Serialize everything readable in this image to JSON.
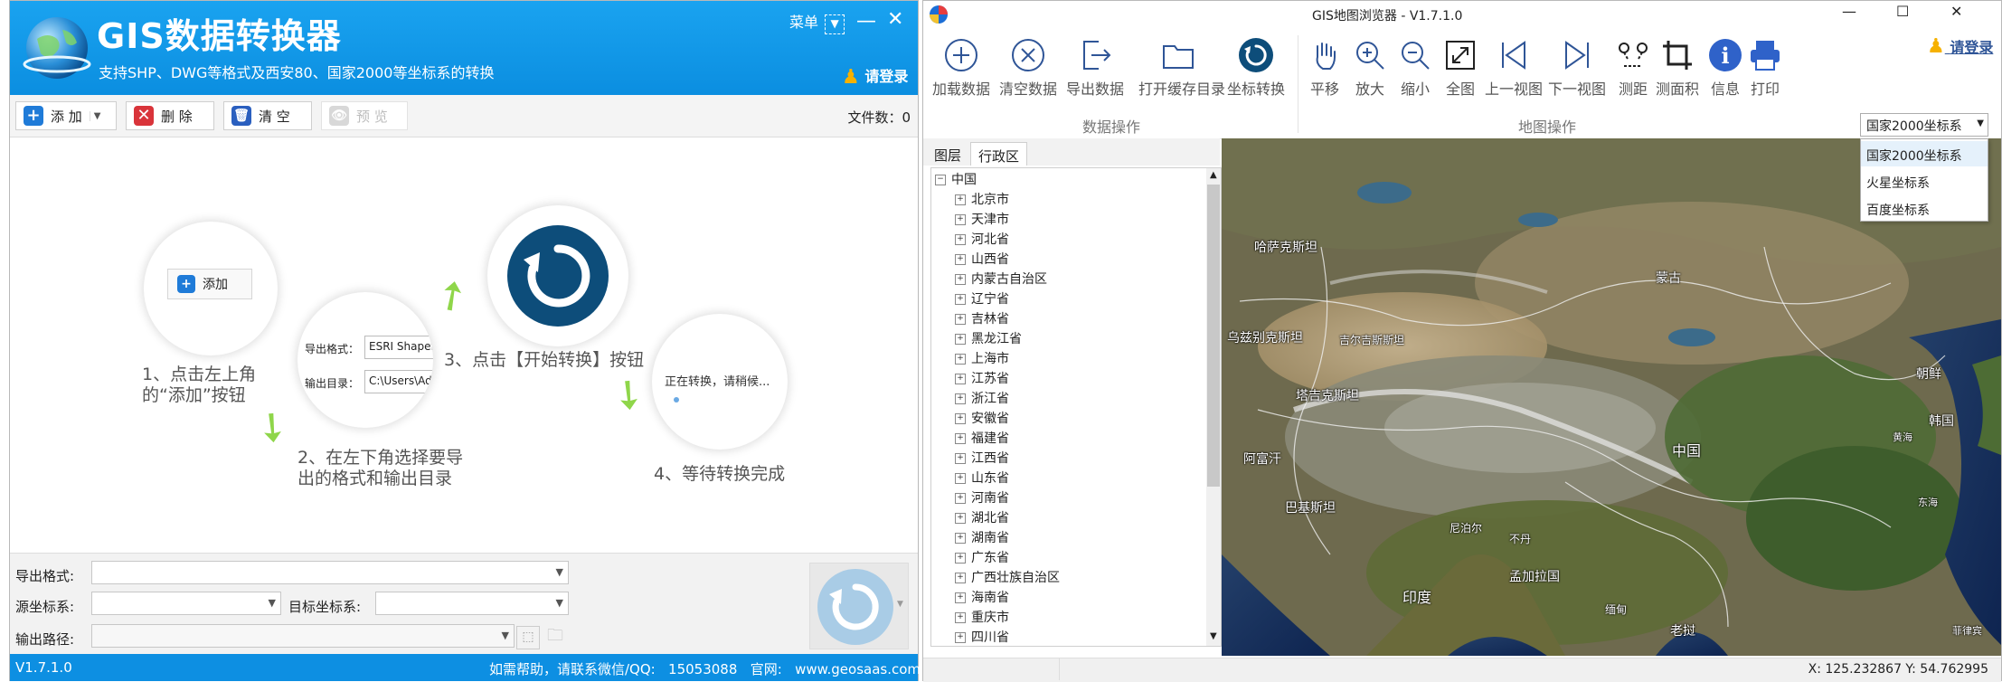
{
  "left_window": {
    "title": "GIS数据转换器",
    "subtitle": "支持SHP、DWG等格式及西安80、国家2000等坐标系的转换",
    "menu_label": "菜单",
    "login_label": "请登录",
    "toolbar": {
      "add_label": "添 加",
      "delete_label": "删 除",
      "clear_label": "清 空",
      "preview_label": "预 览",
      "file_count": "文件数：0"
    },
    "steps": {
      "step1_button": "添加",
      "step1_text_line1": "1、点击左上角",
      "step1_text_line2": "的“添加”按钮",
      "step2_format_label": "导出格式：",
      "step2_format_value": "ESRI Shapefile",
      "step2_dir_label": "输出目录：",
      "step2_dir_value": "C:\\Users\\Adm",
      "step2_text_line1": "2、在左下角选择要导",
      "step2_text_line2": "出的格式和输出目录",
      "step3_text": "3、点击【开始转换】按钮",
      "step4_circle_text": "正在转换，请稍候...",
      "step4_text": "4、等待转换完成"
    },
    "bottom": {
      "export_format_label": "导出格式:",
      "export_format_value": "",
      "source_crs_label": "源坐标系:",
      "source_crs_value": "",
      "target_crs_label": "目标坐标系:",
      "target_crs_value": "",
      "output_path_label": "输出路径:",
      "output_path_value": ""
    },
    "status": {
      "version": "V1.7.1.0",
      "help_text": "如需帮助，请联系微信/QQ:",
      "qq": "15053088",
      "site_label": "官网:",
      "site": "www.geosaas.com"
    }
  },
  "right_window": {
    "title": "GIS地图浏览器 - V1.7.1.0",
    "login_label": "请登录",
    "data_ops": {
      "group_label": "数据操作",
      "buttons": [
        "加载数据",
        "清空数据",
        "导出数据",
        "打开缓存目录",
        "坐标转换"
      ]
    },
    "map_ops": {
      "group_label": "地图操作",
      "buttons": [
        "平移",
        "放大",
        "缩小",
        "全图",
        "上一视图",
        "下一视图",
        "测距",
        "测面积",
        "信息",
        "打印"
      ]
    },
    "crs_select": {
      "value": "国家2000坐标系",
      "options": [
        "国家2000坐标系",
        "火星坐标系",
        "百度坐标系"
      ]
    },
    "tabs": [
      "图层",
      "行政区"
    ],
    "tree": {
      "root": "中国",
      "items": [
        "北京市",
        "天津市",
        "河北省",
        "山西省",
        "内蒙古自治区",
        "辽宁省",
        "吉林省",
        "黑龙江省",
        "上海市",
        "江苏省",
        "浙江省",
        "安徽省",
        "福建省",
        "江西省",
        "山东省",
        "河南省",
        "湖北省",
        "湖南省",
        "广东省",
        "广西壮族自治区",
        "海南省",
        "重庆市",
        "四川省"
      ]
    },
    "map_labels": {
      "kazakhstan": "哈萨克斯坦",
      "mongolia": "蒙古",
      "uzbekistan": "乌兹别克斯坦",
      "kyrgyzstan": "吉尔吉斯斯坦",
      "tajikistan": "塔吉克斯坦",
      "afghanistan": "阿富汗",
      "pakistan": "巴基斯坦",
      "china": "中国",
      "nepal": "尼泊尔",
      "bhutan": "不丹",
      "bangladesh": "孟加拉国",
      "india": "印度",
      "myanmar": "缅甸",
      "laos": "老挝",
      "north_korea": "朝鲜",
      "south_korea": "韩国",
      "yellow_sea": "黄海",
      "east_sea": "东海",
      "philippines": "菲律宾"
    },
    "status": {
      "coords": "X: 125.232867  Y: 54.762995"
    }
  },
  "colors": {
    "left_header": "#0d8fe2",
    "ribbon_icon": "#2f5597",
    "arrow_green": "#8fd64a",
    "convert_dark": "#0d4d7a"
  }
}
